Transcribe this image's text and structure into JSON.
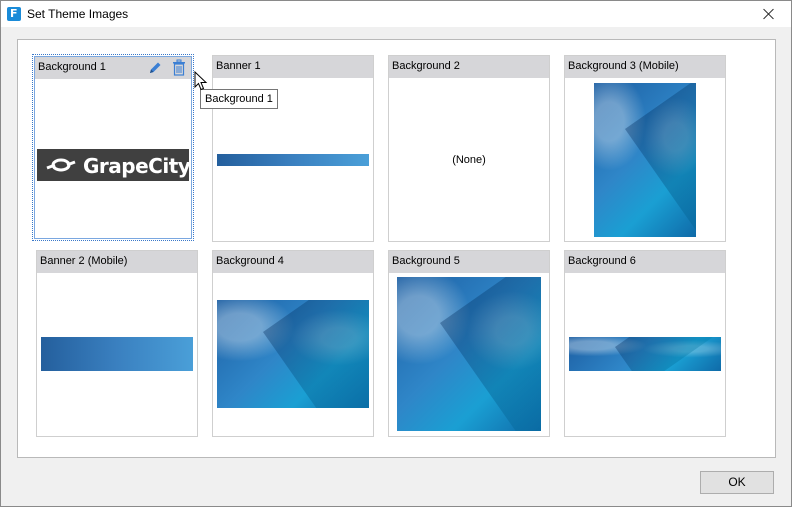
{
  "window": {
    "title": "Set Theme Images",
    "icon": "app-logo-icon",
    "icon_letter": "F"
  },
  "tiles": [
    {
      "label": "Background 1",
      "content": "grapecity-logo",
      "selected": true
    },
    {
      "label": "Banner 1",
      "content": "banner-image"
    },
    {
      "label": "Background 2",
      "content": "none",
      "none_text": "(None)"
    },
    {
      "label": "Background 3 (Mobile)",
      "content": "sky-image"
    },
    {
      "label": "Banner 2 (Mobile)",
      "content": "banner-image"
    },
    {
      "label": "Background 4",
      "content": "sky-image"
    },
    {
      "label": "Background 5",
      "content": "sky-image"
    },
    {
      "label": "Background 6",
      "content": "sky-image"
    }
  ],
  "logo": {
    "text": "GrapeCity"
  },
  "tooltip": {
    "text": "Background 1"
  },
  "footer": {
    "ok_label": "OK"
  },
  "colors": {
    "accent": "#1a8bd8",
    "header": "#d6d6d9",
    "selection": "#3a78c9",
    "icon_blue": "#3b7fd4"
  },
  "icons": {
    "edit": "pencil-icon",
    "delete": "trash-icon",
    "close": "close-icon",
    "cursor": "cursor-arrow-icon"
  }
}
